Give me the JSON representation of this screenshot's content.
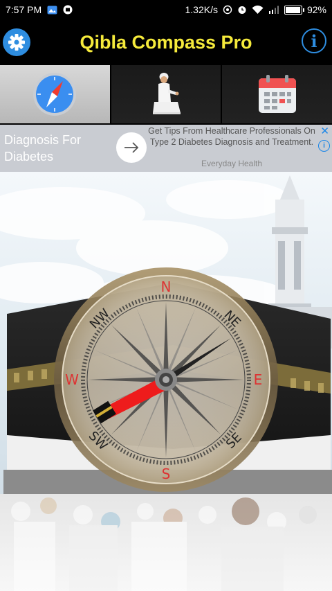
{
  "status_bar": {
    "time": "7:57 PM",
    "network_speed": "1.32K/s",
    "battery": "92%",
    "icons": [
      "gallery-icon",
      "notification-icon",
      "hotspot-icon",
      "alarm-icon",
      "wifi-icon",
      "signal-icon",
      "battery-icon"
    ]
  },
  "app_bar": {
    "title": "Qibla Compass Pro",
    "settings_icon": "gear-icon",
    "info_icon": "info-icon",
    "accent": "#2e8de0",
    "title_color": "#f5ea3b"
  },
  "tabs": [
    {
      "name": "compass",
      "icon": "compass-icon",
      "active": true
    },
    {
      "name": "prayer",
      "icon": "praying-man-icon",
      "active": false
    },
    {
      "name": "calendar",
      "icon": "calendar-icon",
      "active": false
    }
  ],
  "ad": {
    "headline": "Diagnosis For Diabetes",
    "body": "Get Tips From Healthcare Professionals On Type 2 Diabetes Diagnosis and Treatment.",
    "source": "Everyday Health",
    "close": "✕",
    "info": "i"
  },
  "compass": {
    "labels": {
      "n": "N",
      "ne": "NE",
      "e": "E",
      "se": "SE",
      "s": "S",
      "sw": "SW",
      "w": "W",
      "nw": "NW"
    }
  }
}
